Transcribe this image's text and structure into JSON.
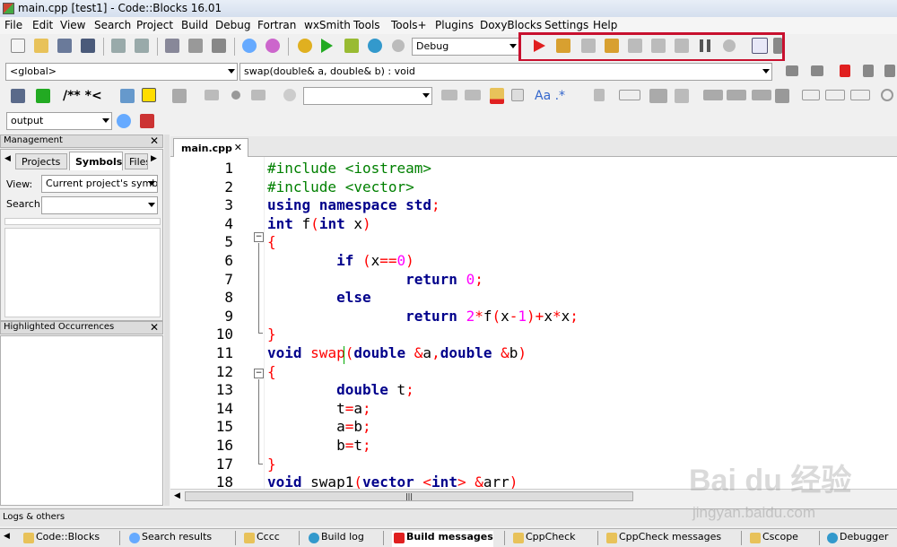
{
  "window": {
    "title": "main.cpp [test1] - Code::Blocks 16.01"
  },
  "menu": [
    "File",
    "Edit",
    "View",
    "Search",
    "Project",
    "Build",
    "Debug",
    "Fortran",
    "wxSmith",
    "Tools",
    "Tools+",
    "Plugins",
    "DoxyBlocks",
    "Settings",
    "Help"
  ],
  "toolbar": {
    "build_target": "Debug",
    "scope": "<global>",
    "function": "swap(double& a, double& b) : void",
    "doxy_comment": "/** *<",
    "search_text": "",
    "log_target": "output",
    "regex_label": "Aa .*"
  },
  "management": {
    "title": "Management",
    "tabs": [
      "Projects",
      "Symbols",
      "Files"
    ],
    "active_tab": "Symbols",
    "view_label": "View:",
    "view_value": "Current project's symb",
    "search_label": "Search:"
  },
  "highlighted": {
    "title": "Highlighted Occurrences"
  },
  "editor": {
    "tab": "main.cpp",
    "lines": [
      {
        "n": "1",
        "tokens": [
          [
            "pp",
            "#include <iostream>"
          ]
        ]
      },
      {
        "n": "2",
        "tokens": [
          [
            "pp",
            "#include <vector>"
          ]
        ]
      },
      {
        "n": "3",
        "tokens": [
          [
            "kw",
            "using namespace"
          ],
          [
            "idn",
            " "
          ],
          [
            "kw",
            "std"
          ],
          [
            "op",
            ";"
          ]
        ]
      },
      {
        "n": "4",
        "tokens": [
          [
            "kw",
            "int"
          ],
          [
            "idn",
            " f"
          ],
          [
            "op",
            "("
          ],
          [
            "kw",
            "int"
          ],
          [
            "idn",
            " x"
          ],
          [
            "op",
            ")"
          ]
        ]
      },
      {
        "n": "5",
        "tokens": [
          [
            "op",
            "{"
          ]
        ]
      },
      {
        "n": "6",
        "tokens": [
          [
            "idn",
            "        "
          ],
          [
            "kw",
            "if"
          ],
          [
            "idn",
            " "
          ],
          [
            "op",
            "("
          ],
          [
            "idn",
            "x"
          ],
          [
            "op",
            "=="
          ],
          [
            "num",
            "0"
          ],
          [
            "op",
            ")"
          ]
        ]
      },
      {
        "n": "7",
        "tokens": [
          [
            "idn",
            "                "
          ],
          [
            "kw",
            "return"
          ],
          [
            "idn",
            " "
          ],
          [
            "num",
            "0"
          ],
          [
            "op",
            ";"
          ]
        ]
      },
      {
        "n": "8",
        "tokens": [
          [
            "idn",
            "        "
          ],
          [
            "kw",
            "else"
          ]
        ]
      },
      {
        "n": "9",
        "tokens": [
          [
            "idn",
            "                "
          ],
          [
            "kw",
            "return"
          ],
          [
            "idn",
            " "
          ],
          [
            "num",
            "2"
          ],
          [
            "op",
            "*"
          ],
          [
            "idn",
            "f"
          ],
          [
            "op",
            "("
          ],
          [
            "idn",
            "x"
          ],
          [
            "op",
            "-"
          ],
          [
            "num",
            "1"
          ],
          [
            "op",
            ")+"
          ],
          [
            "idn",
            "x"
          ],
          [
            "op",
            "*"
          ],
          [
            "idn",
            "x"
          ],
          [
            "op",
            ";"
          ]
        ]
      },
      {
        "n": "10",
        "tokens": [
          [
            "op",
            "}"
          ]
        ]
      },
      {
        "n": "11",
        "tokens": [
          [
            "kw",
            "void"
          ],
          [
            "idn",
            " "
          ],
          [
            "op",
            "swap("
          ],
          [
            "kw",
            "double"
          ],
          [
            "idn",
            " "
          ],
          [
            "op",
            "&"
          ],
          [
            "idn",
            "a"
          ],
          [
            "op",
            ","
          ],
          [
            "kw",
            "double"
          ],
          [
            "idn",
            " "
          ],
          [
            "op",
            "&"
          ],
          [
            "idn",
            "b"
          ],
          [
            "op",
            ")"
          ]
        ]
      },
      {
        "n": "12",
        "tokens": [
          [
            "op",
            "{"
          ]
        ]
      },
      {
        "n": "13",
        "tokens": [
          [
            "idn",
            "        "
          ],
          [
            "kw",
            "double"
          ],
          [
            "idn",
            " t"
          ],
          [
            "op",
            ";"
          ]
        ]
      },
      {
        "n": "14",
        "tokens": [
          [
            "idn",
            "        t"
          ],
          [
            "op",
            "="
          ],
          [
            "idn",
            "a"
          ],
          [
            "op",
            ";"
          ]
        ]
      },
      {
        "n": "15",
        "tokens": [
          [
            "idn",
            "        a"
          ],
          [
            "op",
            "="
          ],
          [
            "idn",
            "b"
          ],
          [
            "op",
            ";"
          ]
        ]
      },
      {
        "n": "16",
        "tokens": [
          [
            "idn",
            "        b"
          ],
          [
            "op",
            "="
          ],
          [
            "idn",
            "t"
          ],
          [
            "op",
            ";"
          ]
        ]
      },
      {
        "n": "17",
        "tokens": [
          [
            "op",
            "}"
          ]
        ]
      },
      {
        "n": "18",
        "tokens": [
          [
            "kw",
            "void"
          ],
          [
            "idn",
            " swap1"
          ],
          [
            "op",
            "("
          ],
          [
            "kw",
            "vector"
          ],
          [
            "idn",
            " "
          ],
          [
            "op",
            "<"
          ],
          [
            "kw",
            "int"
          ],
          [
            "op",
            ">"
          ],
          [
            "idn",
            " "
          ],
          [
            "op",
            "&"
          ],
          [
            "idn",
            "arr"
          ],
          [
            "op",
            ")"
          ]
        ]
      }
    ]
  },
  "logs": {
    "title": "Logs & others",
    "tabs": [
      "Code::Blocks",
      "Search results",
      "Cccc",
      "Build log",
      "Build messages",
      "CppCheck",
      "CppCheck messages",
      "Cscope",
      "Debugger"
    ],
    "active": "Build messages"
  },
  "watermark": {
    "logo": "Bai du 经验",
    "url": "jingyan.baidu.com"
  }
}
